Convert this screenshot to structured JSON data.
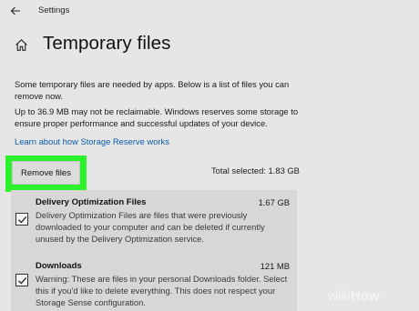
{
  "window": {
    "app_title": "Settings"
  },
  "page": {
    "title": "Temporary files",
    "intro": "Some temporary files are needed by apps. Below is a list of files you can remove now.",
    "reserve_note": "Up to 36.9 MB may not be reclaimable. Windows reserves some storage to ensure proper performance and successful updates of your device.",
    "learn_link": "Learn about how Storage Reserve works"
  },
  "toolbar": {
    "remove_label": "Remove files",
    "total_selected": "Total selected: 1.83 GB",
    "highlight_color": "#2cf22c"
  },
  "items": [
    {
      "name": "Delivery Optimization Files",
      "size": "1.67 GB",
      "checked": true,
      "description": "Delivery Optimization Files are files that were previously downloaded to your computer and can be deleted if currently unused by the Delivery Optimization service."
    },
    {
      "name": "Downloads",
      "size": "121 MB",
      "checked": true,
      "description": "Warning: These are files in your personal Downloads folder. Select this if you'd like to delete everything. This does not respect your Storage Sense configuration."
    }
  ],
  "watermark": {
    "part1": "wiki",
    "part2": "How"
  }
}
